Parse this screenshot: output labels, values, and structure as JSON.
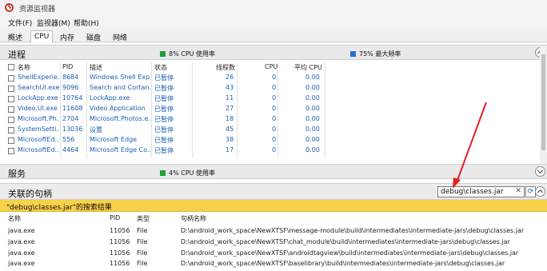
{
  "window": {
    "title": "资源监视器"
  },
  "menu": [
    "文件(F)",
    "监视器(M)",
    "帮助(H)"
  ],
  "tabs": [
    "概述",
    "CPU",
    "内存",
    "磁盘",
    "网络"
  ],
  "active_tab": "CPU",
  "processes_section": {
    "label": "进程",
    "cpu_badge": "8% CPU 使用率",
    "freq_badge": "75% 最大频率",
    "columns": [
      "名称",
      "PID",
      "描述",
      "状态",
      "线程数",
      "CPU",
      "平均 CPU"
    ],
    "rows": [
      [
        "ShellExperie...",
        "8684",
        "Windows Shell Exp...",
        "已暂停",
        "26",
        "0",
        "0.00"
      ],
      [
        "SearchUI.exe",
        "9096",
        "Search and Cortan...",
        "已暂停",
        "43",
        "0",
        "0.00"
      ],
      [
        "LockApp.exe",
        "10764",
        "LockApp.exe",
        "已暂停",
        "11",
        "0",
        "0.00"
      ],
      [
        "Video.UI.exe",
        "11608",
        "Video Application",
        "已暂停",
        "27",
        "0",
        "0.00"
      ],
      [
        "Microsoft.Ph...",
        "2704",
        "Microsoft.Photos.e...",
        "已暂停",
        "18",
        "0",
        "0.00"
      ],
      [
        "SystemSetti...",
        "13036",
        "设置",
        "已暂停",
        "45",
        "0",
        "0.00"
      ],
      [
        "MicrosoftEd...",
        "556",
        "Microsoft Edge",
        "已暂停",
        "38",
        "0",
        "0.00"
      ],
      [
        "MicrosoftEd...",
        "4464",
        "Microsoft Edge Co...",
        "已暂停",
        "17",
        "0",
        "0.00"
      ]
    ]
  },
  "services_section": {
    "label": "服务",
    "cpu_badge": "4% CPU 使用率"
  },
  "handles_section": {
    "label": "关联的句柄",
    "search_value": "debug\\classes.jar",
    "result_text": "\"debug\\classes.jar\"的搜索结果",
    "columns": [
      "名称",
      "PID",
      "类型",
      "句柄名称"
    ],
    "rows": [
      [
        "java.exe",
        "11056",
        "File",
        "D:\\android_work_space\\NewXTSF\\message-module\\build\\intermediates\\intermediate-jars\\debug\\classes.jar"
      ],
      [
        "java.exe",
        "11056",
        "File",
        "D:\\android_work_space\\NewXTSF\\chat_module\\build\\intermediates\\intermediate-jars\\debug\\classes.jar"
      ],
      [
        "java.exe",
        "11056",
        "File",
        "D:\\android_work_space\\NewXTSF\\androidtagview\\build\\intermediates\\intermediate-jars\\debug\\classes.jar"
      ],
      [
        "java.exe",
        "11056",
        "File",
        "D:\\android_work_space\\NewXTSF\\baselibrary\\build\\intermediates\\intermediate-jars\\debug\\classes.jar"
      ]
    ]
  },
  "colors": {
    "cpu_green": "#1e9e3a",
    "freq_blue": "#2a6fd6",
    "result_yellow": "#f6d24a",
    "link_blue": "#1a5fb4",
    "arrow_red": "#e02020"
  }
}
